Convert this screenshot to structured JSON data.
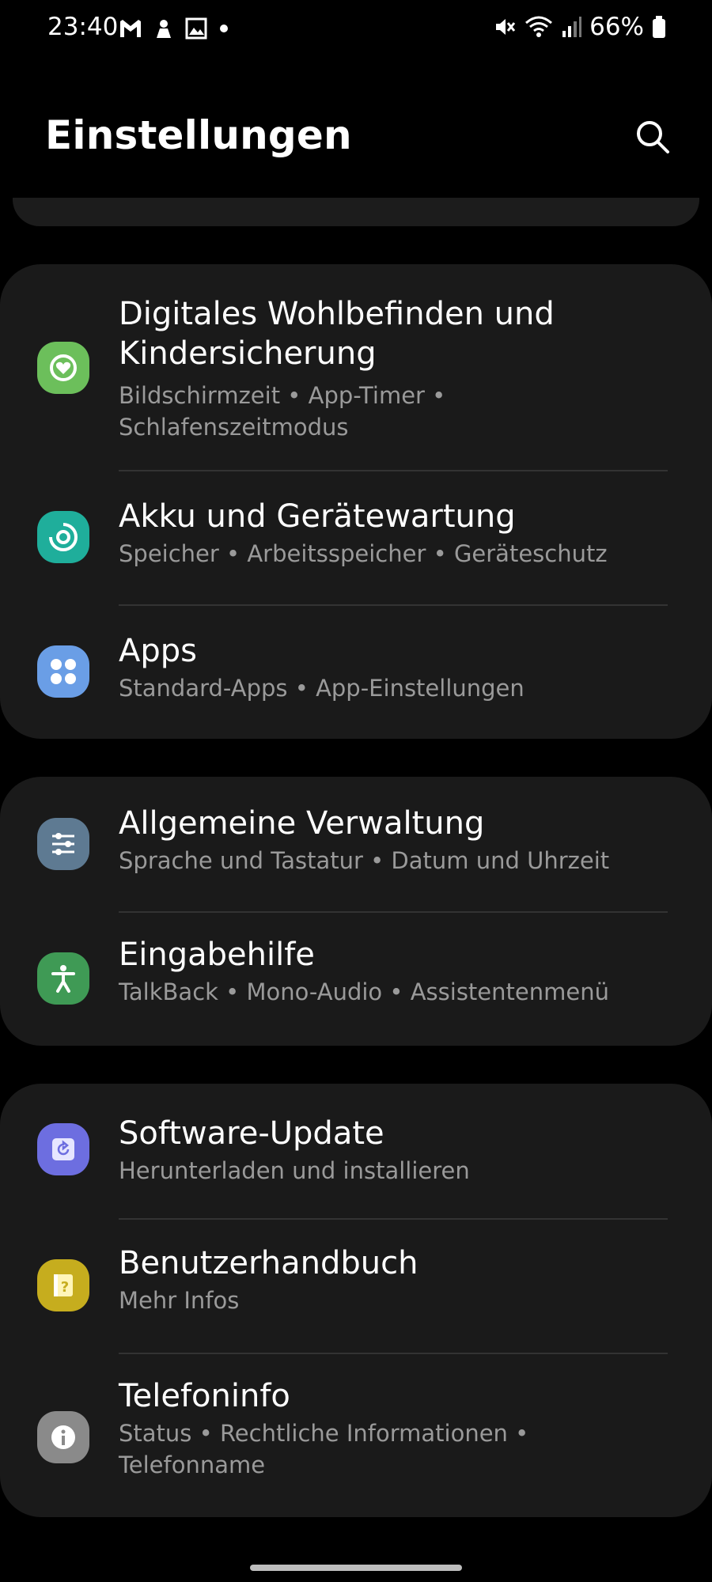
{
  "status_bar": {
    "time": "23:40",
    "left_icons": [
      "gmail-icon",
      "tool-notification-icon",
      "gallery-icon",
      "dot-icon"
    ],
    "battery_percent": "66%"
  },
  "header": {
    "title": "Einstellungen",
    "search_icon": "search-icon"
  },
  "cards": [
    {
      "items": [
        {
          "title": "Digitales Wohlbefinden und Kindersicherung",
          "subtitle": "Bildschirmzeit • App-Timer • Schlafenszeitmodus",
          "icon": "heart-circle-icon",
          "color": "#6cbf5b"
        },
        {
          "title": "Akku und Gerätewartung",
          "subtitle": "Speicher • Arbeitsspeicher • Geräteschutz",
          "icon": "device-care-icon",
          "color": "#1fae9b"
        },
        {
          "title": "Apps",
          "subtitle": "Standard-Apps • App-Einstellungen",
          "icon": "apps-grid-icon",
          "color": "#6a9ee6"
        }
      ]
    },
    {
      "items": [
        {
          "title": "Allgemeine Verwaltung",
          "subtitle": "Sprache und Tastatur • Datum und Uhrzeit",
          "icon": "sliders-icon",
          "color": "#5e7a92"
        },
        {
          "title": "Eingabehilfe",
          "subtitle": "TalkBack • Mono-Audio • Assistentenmenü",
          "icon": "accessibility-icon",
          "color": "#3f9a55"
        }
      ]
    },
    {
      "items": [
        {
          "title": "Software-Update",
          "subtitle": "Herunterladen und installieren",
          "icon": "software-update-icon",
          "color": "#6d6ee0"
        },
        {
          "title": "Benutzerhandbuch",
          "subtitle": "Mehr Infos",
          "icon": "user-manual-icon",
          "color": "#c6ad1e"
        },
        {
          "title": "Telefoninfo",
          "subtitle": "Status • Rechtliche Informationen • Telefonname",
          "icon": "info-icon",
          "color": "#8a8a8a"
        }
      ]
    }
  ]
}
